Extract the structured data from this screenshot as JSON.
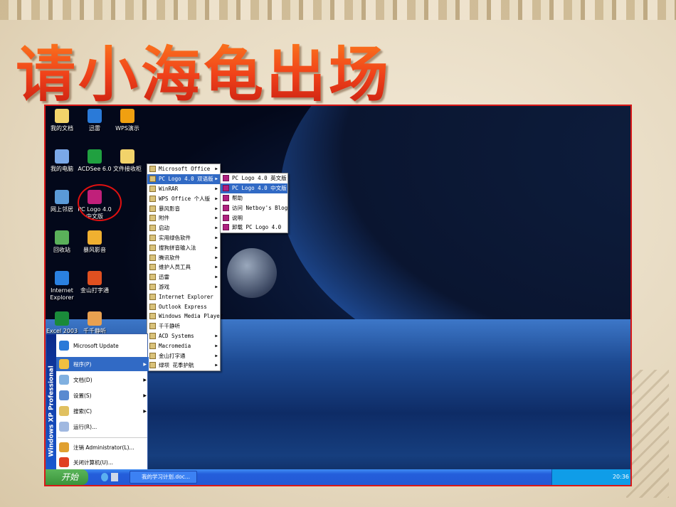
{
  "slide": {
    "title": "请小海龟出场"
  },
  "desktop": {
    "icons": [
      {
        "label": "我的文档",
        "color": "#f2d36a"
      },
      {
        "label": "迅雷",
        "color": "#2a7ad8"
      },
      {
        "label": "WPS演示",
        "color": "#f0a010"
      },
      {
        "label": "我的电脑",
        "color": "#7aa8e8"
      },
      {
        "label": "ACDSee 6.0",
        "color": "#20a040"
      },
      {
        "label": "文件接收柜",
        "color": "#f2d36a"
      },
      {
        "label": "网上邻居",
        "color": "#5a9ad8"
      },
      {
        "label": "PC Logo 4.0 中文版",
        "color": "#c0207a"
      },
      {
        "label": "回收站",
        "color": "#5ab05a"
      },
      {
        "label": "暴风影音",
        "color": "#f0b030"
      },
      {
        "label": "Internet Explorer",
        "color": "#2a80e0"
      },
      {
        "label": "金山打字通",
        "color": "#e05020"
      },
      {
        "label": "Excel 2003",
        "color": "#1a8a3a"
      },
      {
        "label": "千千静听",
        "color": "#e8a050"
      }
    ]
  },
  "programs_menu": {
    "items": [
      {
        "label": "Microsoft Office",
        "sub": true
      },
      {
        "label": "PC Logo 4.0 双语版",
        "sub": true
      },
      {
        "label": "WinRAR",
        "sub": true
      },
      {
        "label": "WPS Office 个人版",
        "sub": true
      },
      {
        "label": "暴风影音",
        "sub": true
      },
      {
        "label": "附件",
        "sub": true
      },
      {
        "label": "启动",
        "sub": true
      },
      {
        "label": "实用绿色软件",
        "sub": true
      },
      {
        "label": "搜狗拼音输入法",
        "sub": true
      },
      {
        "label": "腾讯软件",
        "sub": true
      },
      {
        "label": "维护人员工具",
        "sub": true
      },
      {
        "label": "迅雷",
        "sub": true
      },
      {
        "label": "游戏",
        "sub": true
      },
      {
        "label": "Internet Explorer",
        "sub": false
      },
      {
        "label": "Outlook Express",
        "sub": false
      },
      {
        "label": "Windows Media Player",
        "sub": false
      },
      {
        "label": "千千静听",
        "sub": false
      },
      {
        "label": "ACD Systems",
        "sub": true
      },
      {
        "label": "Macromedia",
        "sub": true
      },
      {
        "label": "金山打字通",
        "sub": true
      },
      {
        "label": "绿坝 花季护航",
        "sub": true
      }
    ]
  },
  "pclogo_menu": {
    "items": [
      {
        "label": "PC Logo 4.0 英文版"
      },
      {
        "label": "PC Logo 4.0 中文版"
      },
      {
        "label": "帮助"
      },
      {
        "label": "访问 Netboy's Blog"
      },
      {
        "label": "说明"
      },
      {
        "label": "卸载 PC Logo 4.0"
      }
    ]
  },
  "start_menu": {
    "brand": "Windows XP Professional",
    "top_item": "Microsoft Update",
    "items": [
      {
        "label": "程序(P)",
        "sub": true
      },
      {
        "label": "文档(D)",
        "sub": true
      },
      {
        "label": "设置(S)",
        "sub": true
      },
      {
        "label": "搜索(C)",
        "sub": true
      },
      {
        "label": "运行(R)...",
        "sub": false
      }
    ],
    "bottom": [
      {
        "label": "注销 Administrator(L)..."
      },
      {
        "label": "关闭计算机(U)..."
      }
    ]
  },
  "taskbar": {
    "start_label": "开始",
    "task": "我的学习计划.doc...",
    "clock": "20:36"
  }
}
